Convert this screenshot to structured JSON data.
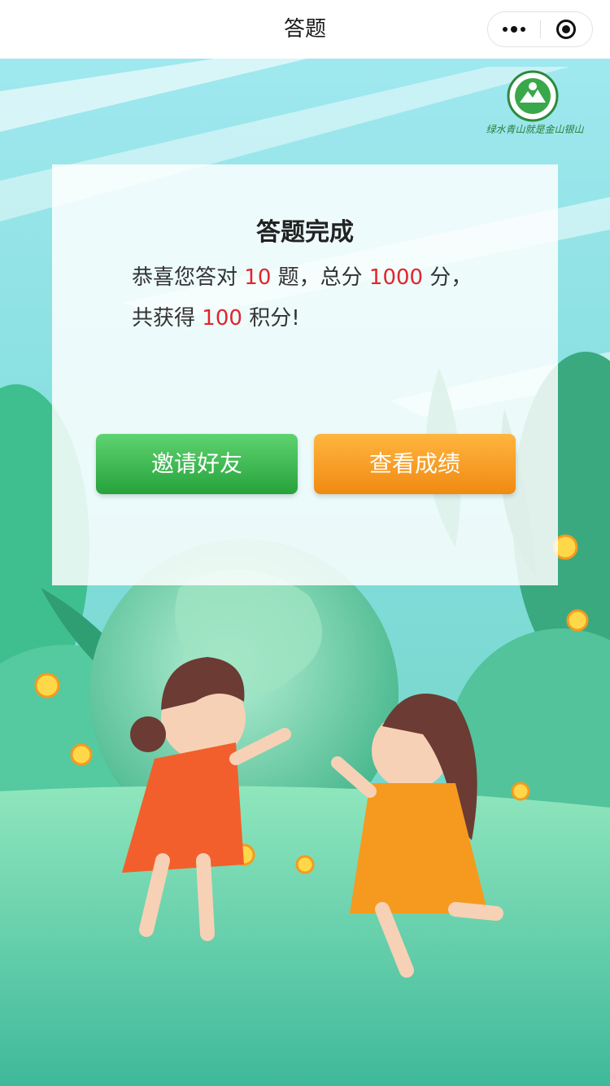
{
  "nav": {
    "title": "答题",
    "more_icon": "more-dots-icon",
    "close_icon": "target-close-icon"
  },
  "logo": {
    "slogan": "绿水青山就是金山银山",
    "icon": "environment-emblem-icon"
  },
  "result": {
    "title": "答题完成",
    "line1_prefix": "恭喜您答对",
    "correct_count": "10",
    "line1_mid": "题，总分",
    "total_score": "1000",
    "line1_suffix": "分，",
    "line2_prefix": "共获得",
    "points": "100",
    "line2_suffix": "积分!"
  },
  "buttons": {
    "invite_label": "邀请好友",
    "score_label": "查看成绩"
  },
  "colors": {
    "highlight": "#e0262d",
    "invite_button": "#34b049",
    "score_button": "#f59a1f"
  }
}
